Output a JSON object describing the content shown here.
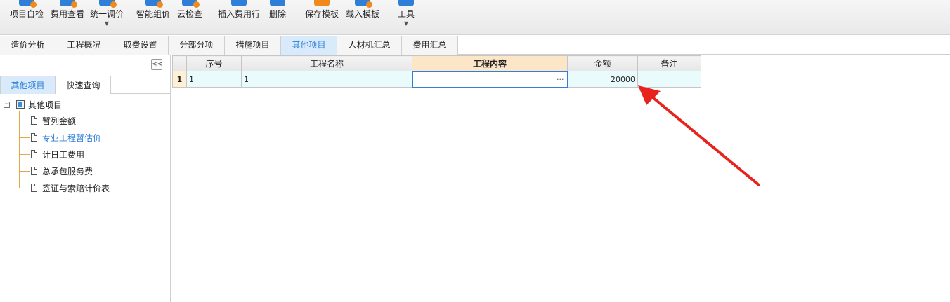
{
  "toolbar": {
    "buttons": [
      {
        "label": "项目自检",
        "icon": "check-icon",
        "color": "blue",
        "dropdown": false
      },
      {
        "label": "费用查看",
        "icon": "fee-view-icon",
        "color": "blue",
        "dropdown": false
      },
      {
        "label": "统一调价",
        "icon": "adjust-price-icon",
        "color": "blue",
        "dropdown": true
      },
      {
        "label": "智能组价",
        "icon": "smart-price-icon",
        "color": "blue",
        "dropdown": false
      },
      {
        "label": "云检查",
        "icon": "cloud-check-icon",
        "color": "blue",
        "dropdown": false
      },
      {
        "label": "插入费用行",
        "icon": "insert-row-icon",
        "color": "blue",
        "dropdown": false
      },
      {
        "label": "删除",
        "icon": "delete-icon",
        "color": "blue",
        "dropdown": false
      },
      {
        "label": "保存模板",
        "icon": "save-template-icon",
        "color": "orange",
        "dropdown": false
      },
      {
        "label": "载入模板",
        "icon": "load-template-icon",
        "color": "blue",
        "dropdown": false
      },
      {
        "label": "工具",
        "icon": "tools-icon",
        "color": "blue",
        "dropdown": true
      }
    ]
  },
  "tabs": [
    {
      "label": "造价分析",
      "active": false
    },
    {
      "label": "工程概况",
      "active": false
    },
    {
      "label": "取费设置",
      "active": false
    },
    {
      "label": "分部分项",
      "active": false
    },
    {
      "label": "措施项目",
      "active": false
    },
    {
      "label": "其他项目",
      "active": true
    },
    {
      "label": "人材机汇总",
      "active": false
    },
    {
      "label": "费用汇总",
      "active": false
    }
  ],
  "left_panel": {
    "collapse_label": "<<",
    "subtabs": [
      {
        "label": "其他项目",
        "active": true
      },
      {
        "label": "快速查询",
        "active": false
      }
    ],
    "tree": {
      "expander": "−",
      "root": "其他项目",
      "items": [
        {
          "label": "暂列金额",
          "selected": false
        },
        {
          "label": "专业工程暂估价",
          "selected": true
        },
        {
          "label": "计日工费用",
          "selected": false
        },
        {
          "label": "总承包服务费",
          "selected": false
        },
        {
          "label": "签证与索赔计价表",
          "selected": false
        }
      ]
    }
  },
  "grid": {
    "columns": [
      "序号",
      "工程名称",
      "工程内容",
      "金额",
      "备注"
    ],
    "highlight_column": 2,
    "rows": [
      {
        "row_number": "1",
        "seq": "1",
        "name": "1",
        "content": "",
        "content_button": "···",
        "amount": "20000",
        "remark": ""
      }
    ]
  },
  "colors": {
    "accent": "#2f7fd8",
    "annotation_arrow": "#e8231d"
  }
}
